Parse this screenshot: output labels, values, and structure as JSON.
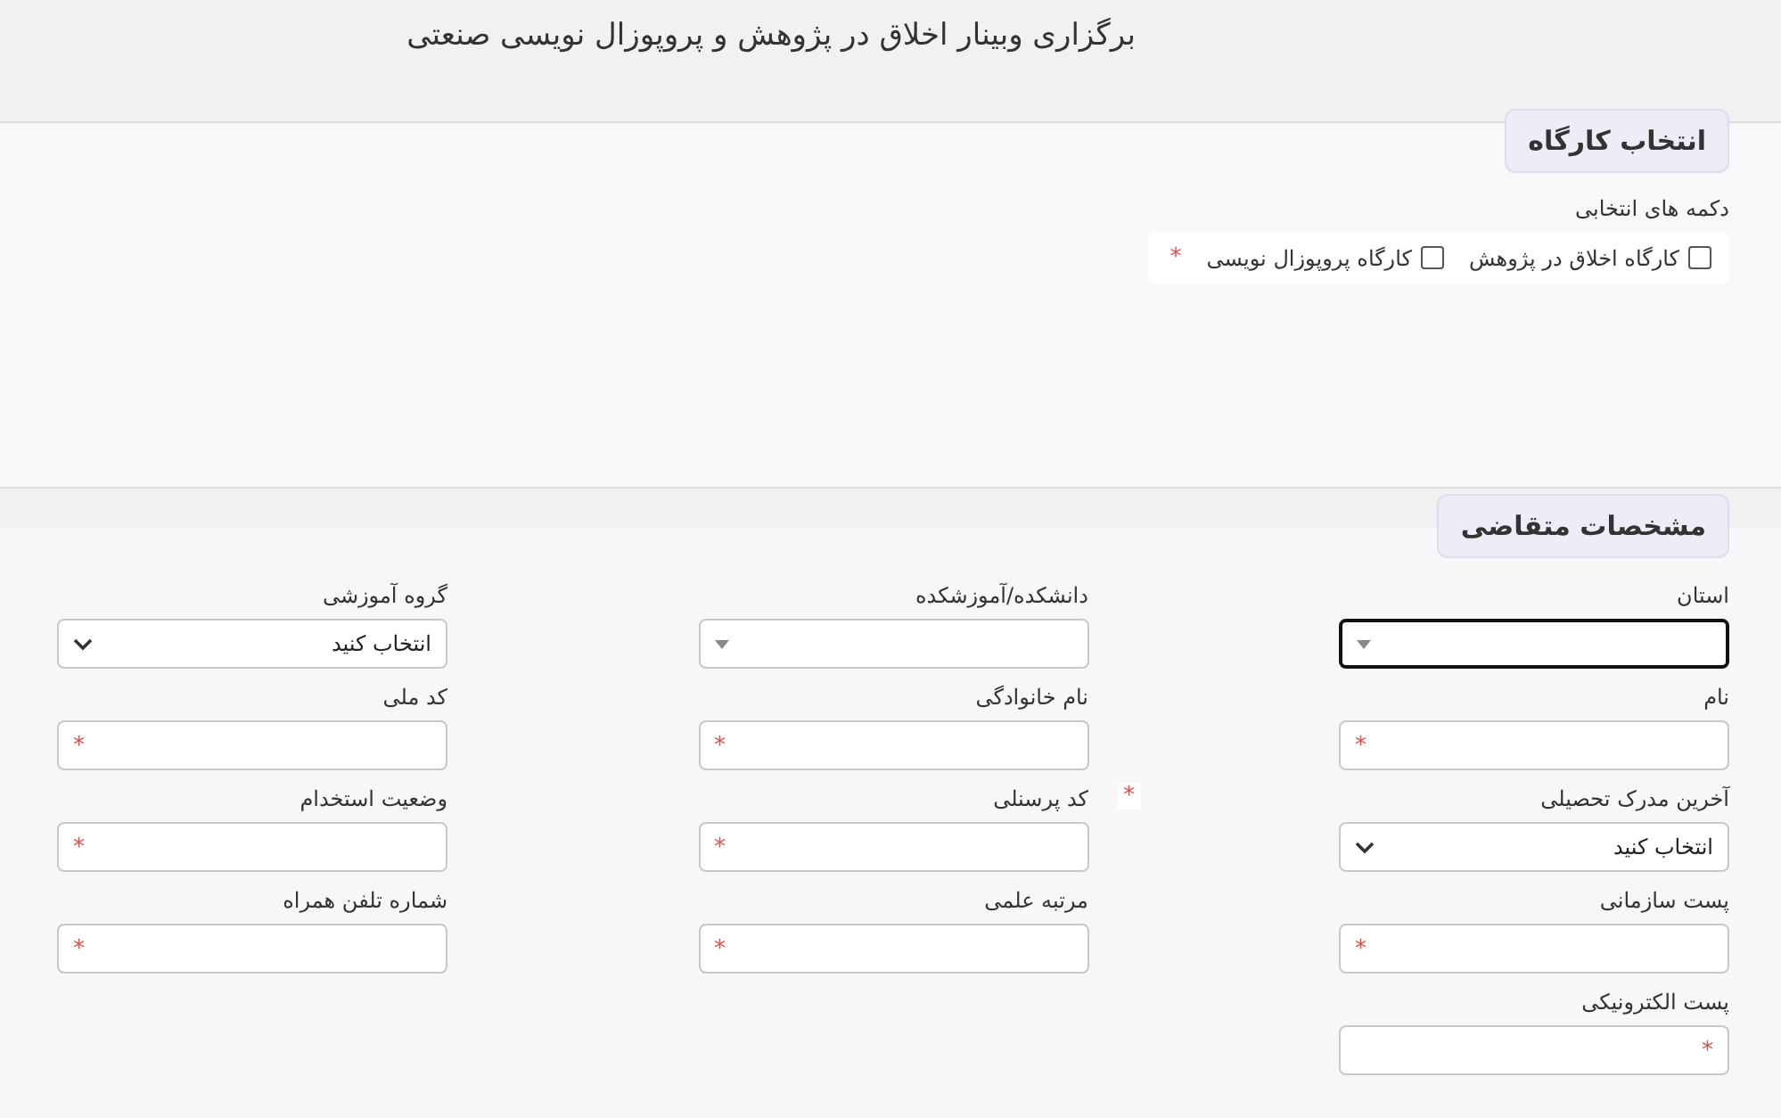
{
  "page": {
    "title": "برگزاری وبینار اخلاق در پژوهش و پروپوزال نویسی صنعتی"
  },
  "workshop_section": {
    "legend": "انتخاب کارگاه",
    "group_label": "دکمه های انتخابی",
    "required_mark": "*",
    "options": [
      {
        "label": "کارگاه اخلاق در پژوهش",
        "checked": false
      },
      {
        "label": "کارگاه پروپوزال نویسی",
        "checked": false
      }
    ]
  },
  "applicant_section": {
    "legend": "مشخصات متقاضی",
    "fields": [
      {
        "label": "استان",
        "kind": "search-select",
        "focused": true
      },
      {
        "label": "دانشکده/آموزشکده",
        "kind": "search-select",
        "focused": false
      },
      {
        "label": "گروه آموزشی",
        "kind": "select",
        "value": "انتخاب کنید",
        "focused": false
      },
      {
        "label": "نام",
        "kind": "text",
        "mark": {
          "text": "*",
          "kind": "start"
        },
        "focused": false
      },
      {
        "label": "نام خانوادگی",
        "kind": "text",
        "mark": {
          "text": "*",
          "kind": "start"
        },
        "focused": false
      },
      {
        "label": "کد ملی",
        "kind": "text",
        "mark": {
          "text": "*",
          "kind": "start"
        },
        "focused": false
      },
      {
        "label": "آخرین مدرک تحصیلی",
        "kind": "select",
        "value": "انتخاب کنید",
        "mark": {
          "text": "*",
          "kind": "outside"
        },
        "focused": false
      },
      {
        "label": "کد پرسنلی",
        "kind": "text",
        "mark": {
          "text": "*",
          "kind": "start"
        },
        "focused": false
      },
      {
        "label": "وضعیت استخدام",
        "kind": "text",
        "mark": {
          "text": "*",
          "kind": "start"
        },
        "focused": false
      },
      {
        "label": "پست سازمانی",
        "kind": "text",
        "mark": {
          "text": "*",
          "kind": "start"
        },
        "focused": false
      },
      {
        "label": "مرتبه علمی",
        "kind": "text",
        "mark": {
          "text": "*",
          "kind": "start"
        },
        "focused": false
      },
      {
        "label": "شماره تلفن همراه",
        "kind": "text",
        "mark": {
          "text": "*",
          "kind": "start"
        },
        "focused": false
      },
      {
        "label": "پست الکترونیکی",
        "kind": "text",
        "mark": {
          "text": "*",
          "kind": "end"
        },
        "focused": false
      }
    ]
  }
}
